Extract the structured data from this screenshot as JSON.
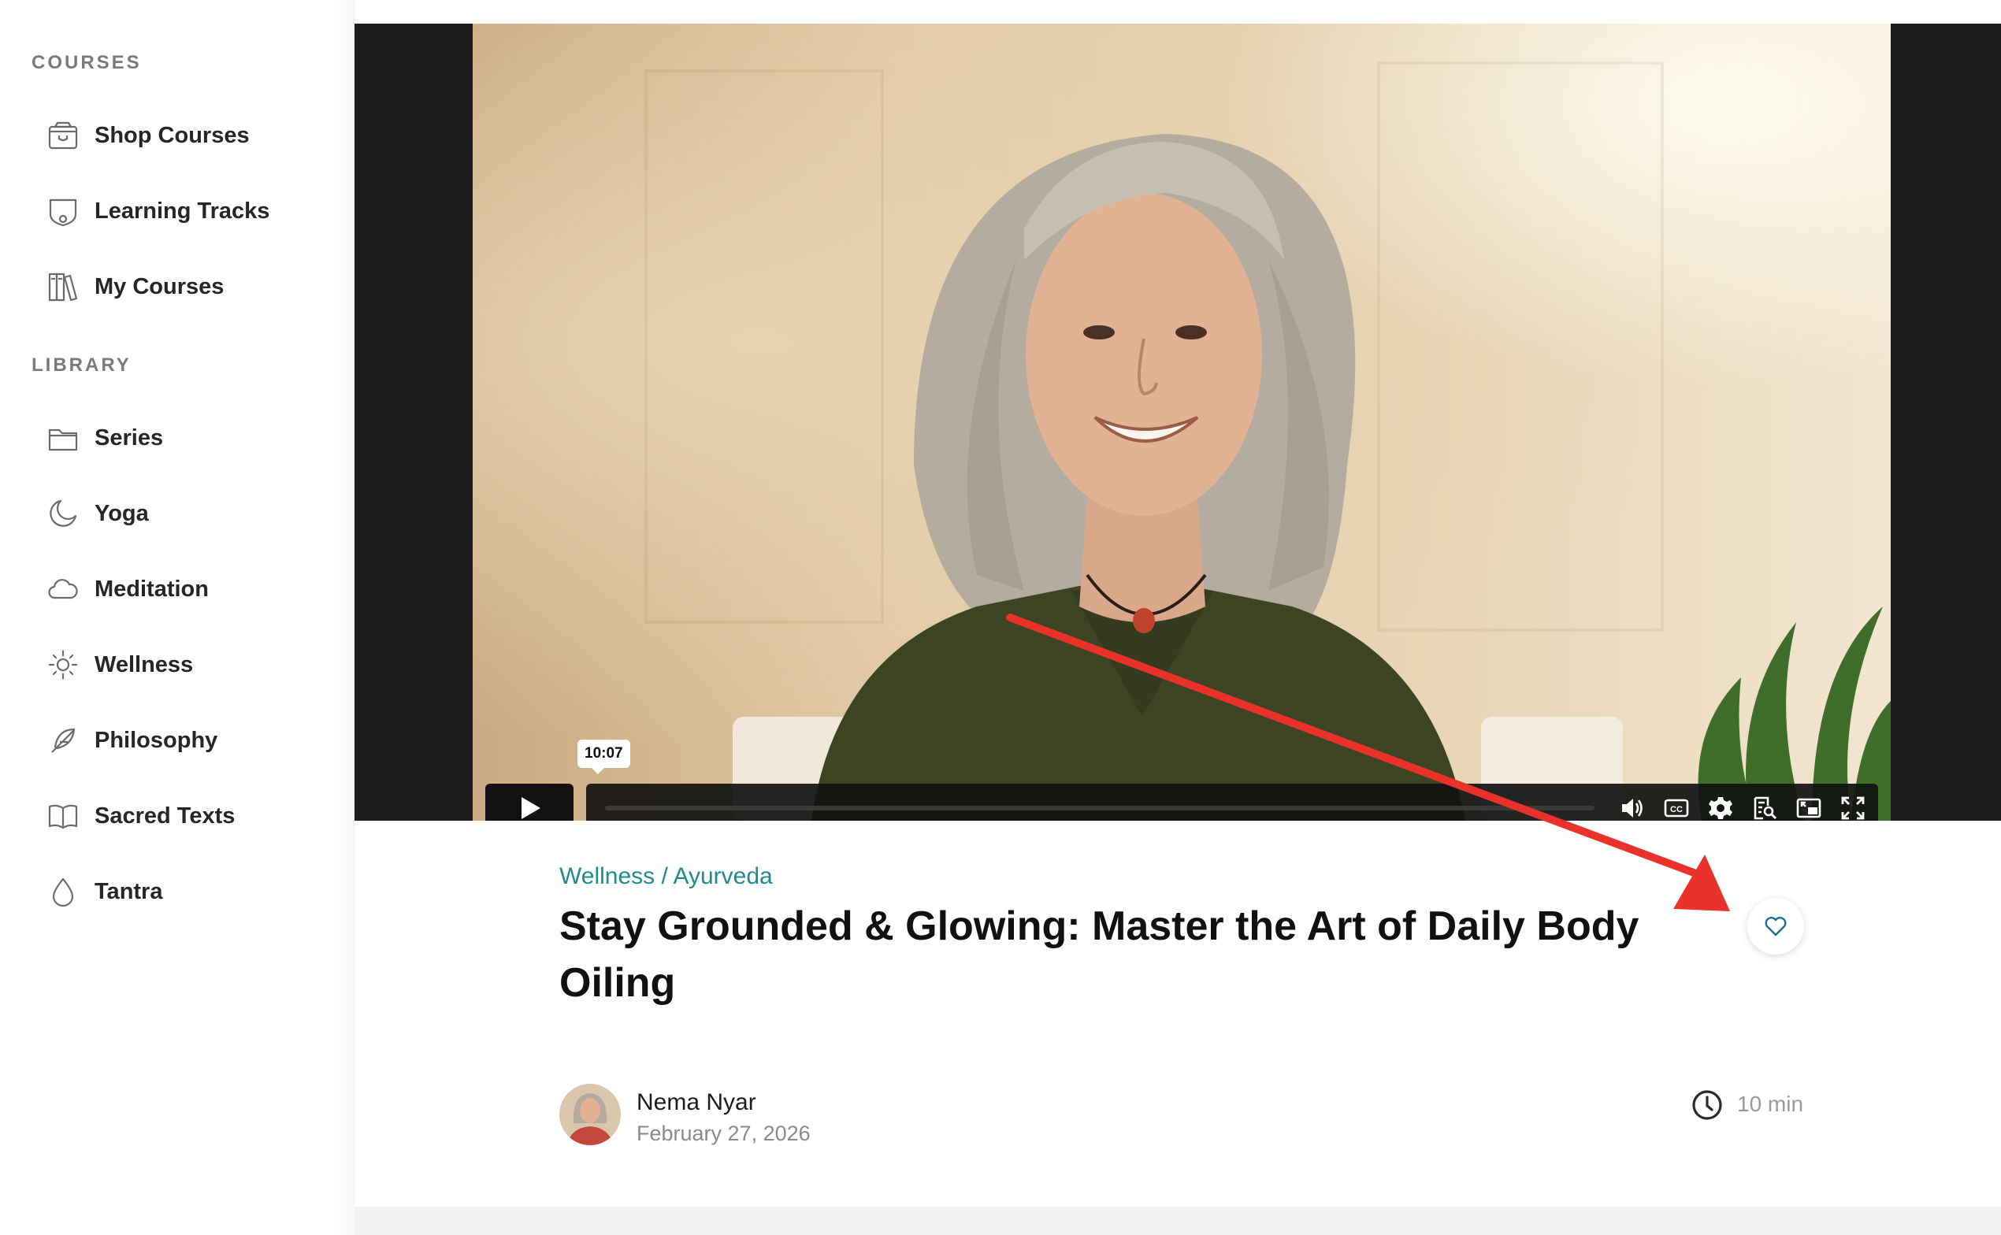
{
  "sidebar": {
    "courses_heading": "COURSES",
    "courses": [
      {
        "label": "Shop Courses",
        "icon": "shop-bag-icon"
      },
      {
        "label": "Learning Tracks",
        "icon": "shield-track-icon"
      },
      {
        "label": "My Courses",
        "icon": "books-icon"
      }
    ],
    "library_heading": "LIBRARY",
    "library": [
      {
        "label": "Series",
        "icon": "folder-icon"
      },
      {
        "label": "Yoga",
        "icon": "moon-icon"
      },
      {
        "label": "Meditation",
        "icon": "cloud-icon"
      },
      {
        "label": "Wellness",
        "icon": "sun-icon"
      },
      {
        "label": "Philosophy",
        "icon": "feather-icon"
      },
      {
        "label": "Sacred Texts",
        "icon": "open-book-icon"
      },
      {
        "label": "Tantra",
        "icon": "drop-icon"
      }
    ]
  },
  "player": {
    "tooltip_time": "10:07",
    "progress": 0,
    "controls": [
      "volume-icon",
      "captions-icon",
      "settings-icon",
      "transcript-icon",
      "picture-in-picture-icon",
      "fullscreen-icon"
    ]
  },
  "article": {
    "breadcrumb": "Wellness / Ayurveda",
    "title": "Stay Grounded & Glowing: Master the Art of Daily Body Oiling",
    "author": "Nema Nyar",
    "date": "February 27, 2026",
    "duration": "10 min"
  },
  "colors": {
    "accent_teal": "#1f8b8c",
    "annotation_arrow": "#e8322a"
  }
}
